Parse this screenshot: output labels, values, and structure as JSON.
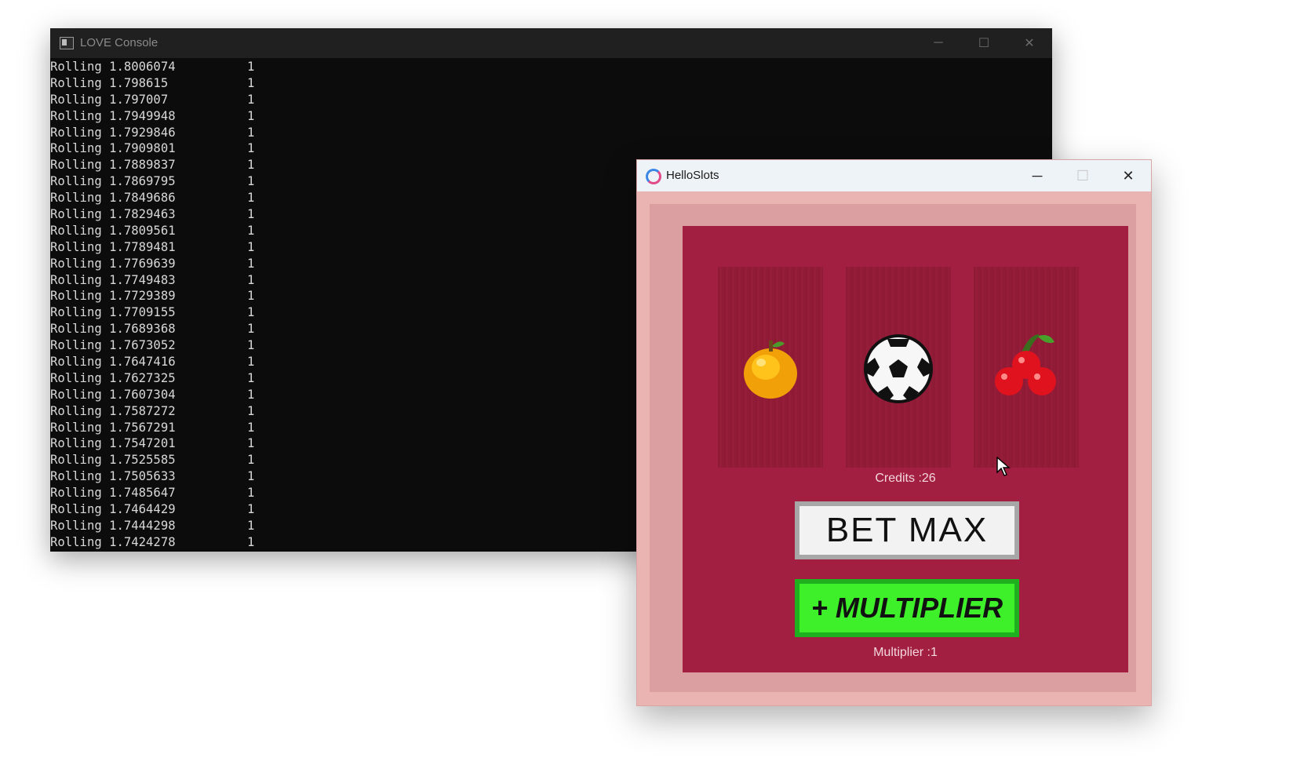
{
  "console": {
    "title": "LOVE Console",
    "minimize": "─",
    "maximize": "☐",
    "close": "✕",
    "lines": [
      {
        "label": "Rolling 1.8006074",
        "value": "1"
      },
      {
        "label": "Rolling 1.798615",
        "value": "1"
      },
      {
        "label": "Rolling 1.797007",
        "value": "1"
      },
      {
        "label": "Rolling 1.7949948",
        "value": "1"
      },
      {
        "label": "Rolling 1.7929846",
        "value": "1"
      },
      {
        "label": "Rolling 1.7909801",
        "value": "1"
      },
      {
        "label": "Rolling 1.7889837",
        "value": "1"
      },
      {
        "label": "Rolling 1.7869795",
        "value": "1"
      },
      {
        "label": "Rolling 1.7849686",
        "value": "1"
      },
      {
        "label": "Rolling 1.7829463",
        "value": "1"
      },
      {
        "label": "Rolling 1.7809561",
        "value": "1"
      },
      {
        "label": "Rolling 1.7789481",
        "value": "1"
      },
      {
        "label": "Rolling 1.7769639",
        "value": "1"
      },
      {
        "label": "Rolling 1.7749483",
        "value": "1"
      },
      {
        "label": "Rolling 1.7729389",
        "value": "1"
      },
      {
        "label": "Rolling 1.7709155",
        "value": "1"
      },
      {
        "label": "Rolling 1.7689368",
        "value": "1"
      },
      {
        "label": "Rolling 1.7673052",
        "value": "1"
      },
      {
        "label": "Rolling 1.7647416",
        "value": "1"
      },
      {
        "label": "Rolling 1.7627325",
        "value": "1"
      },
      {
        "label": "Rolling 1.7607304",
        "value": "1"
      },
      {
        "label": "Rolling 1.7587272",
        "value": "1"
      },
      {
        "label": "Rolling 1.7567291",
        "value": "1"
      },
      {
        "label": "Rolling 1.7547201",
        "value": "1"
      },
      {
        "label": "Rolling 1.7525585",
        "value": "1"
      },
      {
        "label": "Rolling 1.7505633",
        "value": "1"
      },
      {
        "label": "Rolling 1.7485647",
        "value": "1"
      },
      {
        "label": "Rolling 1.7464429",
        "value": "1"
      },
      {
        "label": "Rolling 1.7444298",
        "value": "1"
      },
      {
        "label": "Rolling 1.7424278",
        "value": "1"
      }
    ]
  },
  "slots": {
    "title": "HelloSlots",
    "minimize": "─",
    "maximize": "☐",
    "close": "✕",
    "reels": [
      "orange-icon",
      "soccer-ball-icon",
      "cherries-icon"
    ],
    "credits": "Credits :26",
    "bet_max_label": "BET MAX",
    "multiplier_button_label": "+ MULTIPLIER",
    "multiplier": "Multiplier :1",
    "colors": {
      "board": "#a31f41",
      "frame": "#e9b4b2",
      "bet_button": "#f2f2f2",
      "multiplier_button": "#3ef02a"
    }
  }
}
